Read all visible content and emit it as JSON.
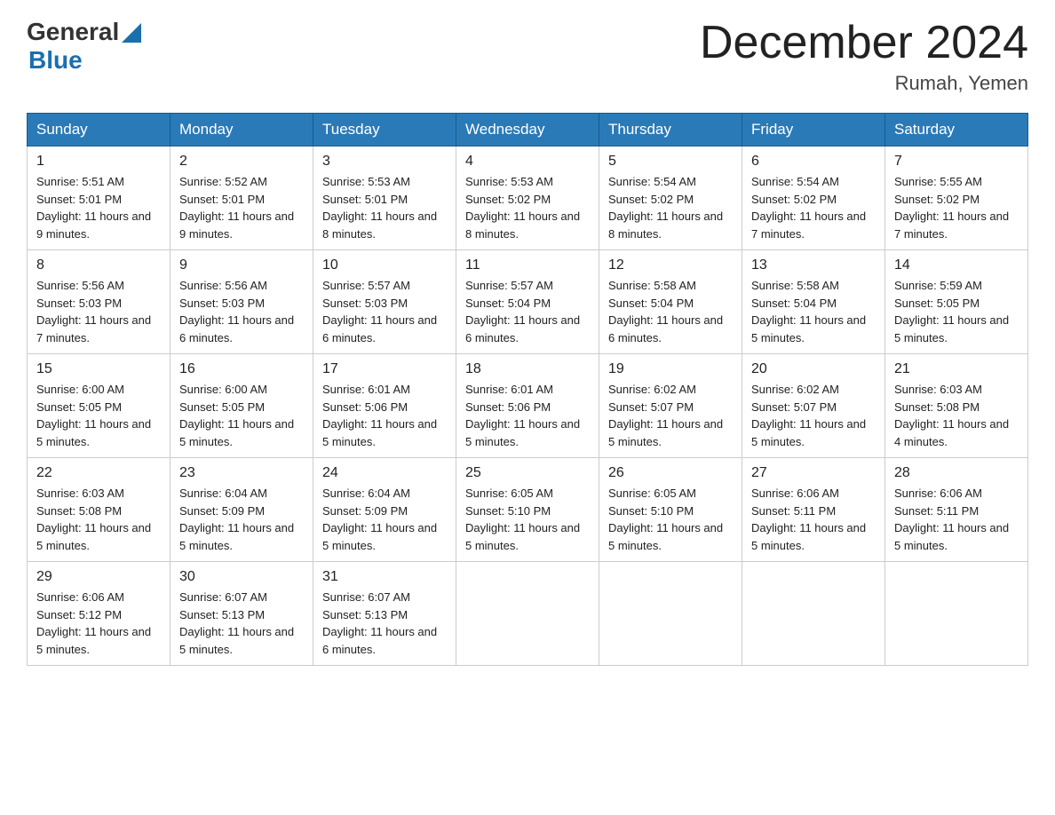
{
  "header": {
    "logo_general": "General",
    "logo_blue": "Blue",
    "title": "December 2024",
    "subtitle": "Rumah, Yemen"
  },
  "days_of_week": [
    "Sunday",
    "Monday",
    "Tuesday",
    "Wednesday",
    "Thursday",
    "Friday",
    "Saturday"
  ],
  "weeks": [
    [
      {
        "day": "1",
        "sunrise": "5:51 AM",
        "sunset": "5:01 PM",
        "daylight": "11 hours and 9 minutes."
      },
      {
        "day": "2",
        "sunrise": "5:52 AM",
        "sunset": "5:01 PM",
        "daylight": "11 hours and 9 minutes."
      },
      {
        "day": "3",
        "sunrise": "5:53 AM",
        "sunset": "5:01 PM",
        "daylight": "11 hours and 8 minutes."
      },
      {
        "day": "4",
        "sunrise": "5:53 AM",
        "sunset": "5:02 PM",
        "daylight": "11 hours and 8 minutes."
      },
      {
        "day": "5",
        "sunrise": "5:54 AM",
        "sunset": "5:02 PM",
        "daylight": "11 hours and 8 minutes."
      },
      {
        "day": "6",
        "sunrise": "5:54 AM",
        "sunset": "5:02 PM",
        "daylight": "11 hours and 7 minutes."
      },
      {
        "day": "7",
        "sunrise": "5:55 AM",
        "sunset": "5:02 PM",
        "daylight": "11 hours and 7 minutes."
      }
    ],
    [
      {
        "day": "8",
        "sunrise": "5:56 AM",
        "sunset": "5:03 PM",
        "daylight": "11 hours and 7 minutes."
      },
      {
        "day": "9",
        "sunrise": "5:56 AM",
        "sunset": "5:03 PM",
        "daylight": "11 hours and 6 minutes."
      },
      {
        "day": "10",
        "sunrise": "5:57 AM",
        "sunset": "5:03 PM",
        "daylight": "11 hours and 6 minutes."
      },
      {
        "day": "11",
        "sunrise": "5:57 AM",
        "sunset": "5:04 PM",
        "daylight": "11 hours and 6 minutes."
      },
      {
        "day": "12",
        "sunrise": "5:58 AM",
        "sunset": "5:04 PM",
        "daylight": "11 hours and 6 minutes."
      },
      {
        "day": "13",
        "sunrise": "5:58 AM",
        "sunset": "5:04 PM",
        "daylight": "11 hours and 5 minutes."
      },
      {
        "day": "14",
        "sunrise": "5:59 AM",
        "sunset": "5:05 PM",
        "daylight": "11 hours and 5 minutes."
      }
    ],
    [
      {
        "day": "15",
        "sunrise": "6:00 AM",
        "sunset": "5:05 PM",
        "daylight": "11 hours and 5 minutes."
      },
      {
        "day": "16",
        "sunrise": "6:00 AM",
        "sunset": "5:05 PM",
        "daylight": "11 hours and 5 minutes."
      },
      {
        "day": "17",
        "sunrise": "6:01 AM",
        "sunset": "5:06 PM",
        "daylight": "11 hours and 5 minutes."
      },
      {
        "day": "18",
        "sunrise": "6:01 AM",
        "sunset": "5:06 PM",
        "daylight": "11 hours and 5 minutes."
      },
      {
        "day": "19",
        "sunrise": "6:02 AM",
        "sunset": "5:07 PM",
        "daylight": "11 hours and 5 minutes."
      },
      {
        "day": "20",
        "sunrise": "6:02 AM",
        "sunset": "5:07 PM",
        "daylight": "11 hours and 5 minutes."
      },
      {
        "day": "21",
        "sunrise": "6:03 AM",
        "sunset": "5:08 PM",
        "daylight": "11 hours and 4 minutes."
      }
    ],
    [
      {
        "day": "22",
        "sunrise": "6:03 AM",
        "sunset": "5:08 PM",
        "daylight": "11 hours and 5 minutes."
      },
      {
        "day": "23",
        "sunrise": "6:04 AM",
        "sunset": "5:09 PM",
        "daylight": "11 hours and 5 minutes."
      },
      {
        "day": "24",
        "sunrise": "6:04 AM",
        "sunset": "5:09 PM",
        "daylight": "11 hours and 5 minutes."
      },
      {
        "day": "25",
        "sunrise": "6:05 AM",
        "sunset": "5:10 PM",
        "daylight": "11 hours and 5 minutes."
      },
      {
        "day": "26",
        "sunrise": "6:05 AM",
        "sunset": "5:10 PM",
        "daylight": "11 hours and 5 minutes."
      },
      {
        "day": "27",
        "sunrise": "6:06 AM",
        "sunset": "5:11 PM",
        "daylight": "11 hours and 5 minutes."
      },
      {
        "day": "28",
        "sunrise": "6:06 AM",
        "sunset": "5:11 PM",
        "daylight": "11 hours and 5 minutes."
      }
    ],
    [
      {
        "day": "29",
        "sunrise": "6:06 AM",
        "sunset": "5:12 PM",
        "daylight": "11 hours and 5 minutes."
      },
      {
        "day": "30",
        "sunrise": "6:07 AM",
        "sunset": "5:13 PM",
        "daylight": "11 hours and 5 minutes."
      },
      {
        "day": "31",
        "sunrise": "6:07 AM",
        "sunset": "5:13 PM",
        "daylight": "11 hours and 6 minutes."
      },
      null,
      null,
      null,
      null
    ]
  ]
}
